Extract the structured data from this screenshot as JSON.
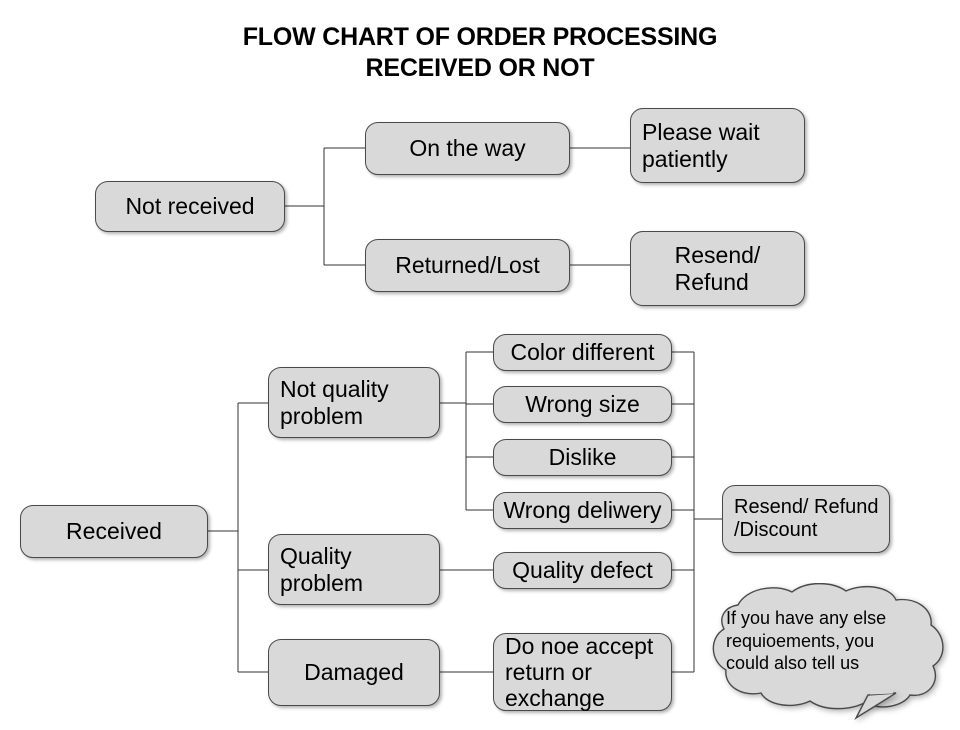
{
  "title": "FLOW CHART OF ORDER PROCESSING\nRECEIVED OR NOT",
  "colors": {
    "node_fill": "#d9d9d9",
    "node_border": "#4a4a4a",
    "line": "#333333",
    "background": "#ffffff",
    "text": "#000000"
  },
  "sections": {
    "not_received": {
      "root": "Not received",
      "branches": [
        {
          "label": "On the way",
          "outcome": "Please wait\npatiently"
        },
        {
          "label": "Returned/Lost",
          "outcome": "Resend/\nRefund"
        }
      ]
    },
    "received": {
      "root": "Received",
      "branches": [
        {
          "label": "Not quality\nproblem",
          "reasons": [
            "Color different",
            "Wrong size",
            "Dislike",
            "Wrong deliwery"
          ]
        },
        {
          "label": "Quality\nproblem",
          "reasons": [
            "Quality defect"
          ]
        },
        {
          "label": "Damaged",
          "reasons": [
            "Do noe accept\nreturn or\nexchange"
          ]
        }
      ],
      "outcome": "Resend/ Refund\n/Discount"
    }
  },
  "callout": {
    "text": "If you have any else\nrequioements, you\ncould also tell us"
  }
}
